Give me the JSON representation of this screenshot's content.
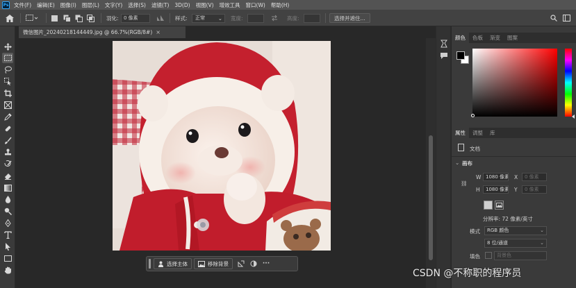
{
  "menubar": {
    "logo": "Ps",
    "items": [
      "文件(F)",
      "编辑(E)",
      "图像(I)",
      "图层(L)",
      "文字(Y)",
      "选择(S)",
      "滤镜(T)",
      "3D(D)",
      "视图(V)",
      "增效工具",
      "窗口(W)",
      "帮助(H)"
    ]
  },
  "options": {
    "feather_label": "羽化:",
    "feather_value": "0 像素",
    "style_label": "样式:",
    "style_value": "正常",
    "width_label": "宽度:",
    "height_label": "高度:",
    "select_mask_button": "选择并遮住..."
  },
  "document": {
    "tab_title": "微信图片_20240218144449.jpg @ 66.7%(RGB/8#)",
    "close_glyph": "×"
  },
  "context_bar": {
    "select_subject": "选择主体",
    "remove_background": "移除背景",
    "more": "···"
  },
  "color_panel": {
    "tabs": [
      "颜色",
      "色板",
      "渐变",
      "图案"
    ],
    "foreground": "#000000",
    "background": "#ffffff"
  },
  "properties_panel": {
    "tabs": [
      "属性",
      "调整",
      "库"
    ],
    "doc_label": "文档",
    "section_title": "画布",
    "w_label": "W",
    "w_value": "1080 像素",
    "h_label": "H",
    "h_value": "1080 像素",
    "x_label": "X",
    "x_placeholder": "0 像素",
    "y_label": "Y",
    "y_placeholder": "0 像素",
    "resolution": "分辨率: 72 像素/英寸",
    "mode_label": "模式",
    "mode_value": "RGB 颜色",
    "depth_value": "8 位/通道",
    "fill_label": "填色",
    "fill_value": "背景色"
  },
  "watermark": "CSDN @不称职的程序员"
}
